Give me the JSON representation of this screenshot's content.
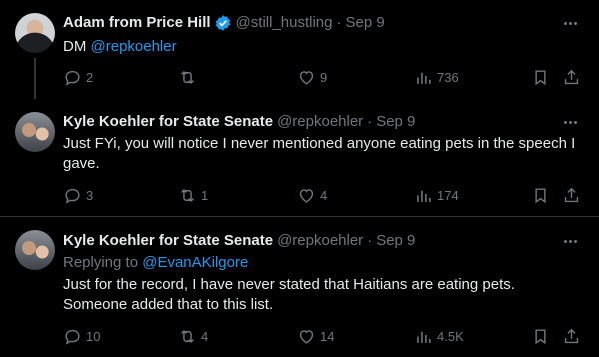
{
  "tweets": [
    {
      "name": "Adam from Price Hill",
      "verified": true,
      "handle": "@still_hustling",
      "separator": "·",
      "date": "Sep 9",
      "text_prefix": "DM ",
      "text_mention": "@repkoehler",
      "counts": {
        "replies": "2",
        "reposts": "",
        "likes": "9",
        "views": "736"
      }
    },
    {
      "name": "Kyle Koehler for State Senate",
      "handle": "@repkoehler",
      "separator": "·",
      "date": "Sep 9",
      "text": "Just FYi, you will notice I never mentioned anyone eating pets in the speech I gave.",
      "counts": {
        "replies": "3",
        "reposts": "1",
        "likes": "4",
        "views": "174"
      }
    },
    {
      "name": "Kyle Koehler for State Senate",
      "handle": "@repkoehler",
      "separator": "·",
      "date": "Sep 9",
      "replying_to_label": "Replying to ",
      "replying_to_handle": "@EvanAKilgore",
      "text": "Just for the record, I have never stated that Haitians are eating pets. Someone added that to this list.",
      "counts": {
        "replies": "10",
        "reposts": "4",
        "likes": "14",
        "views": "4.5K"
      }
    }
  ],
  "colors": {
    "background": "#000000",
    "text": "#e7e9ea",
    "muted": "#71767b",
    "accent": "#1d9bf0",
    "divider": "#2f3336"
  },
  "icons": [
    "more-icon",
    "reply-icon",
    "repost-icon",
    "like-icon",
    "views-icon",
    "bookmark-icon",
    "share-icon",
    "verified-badge-icon"
  ]
}
